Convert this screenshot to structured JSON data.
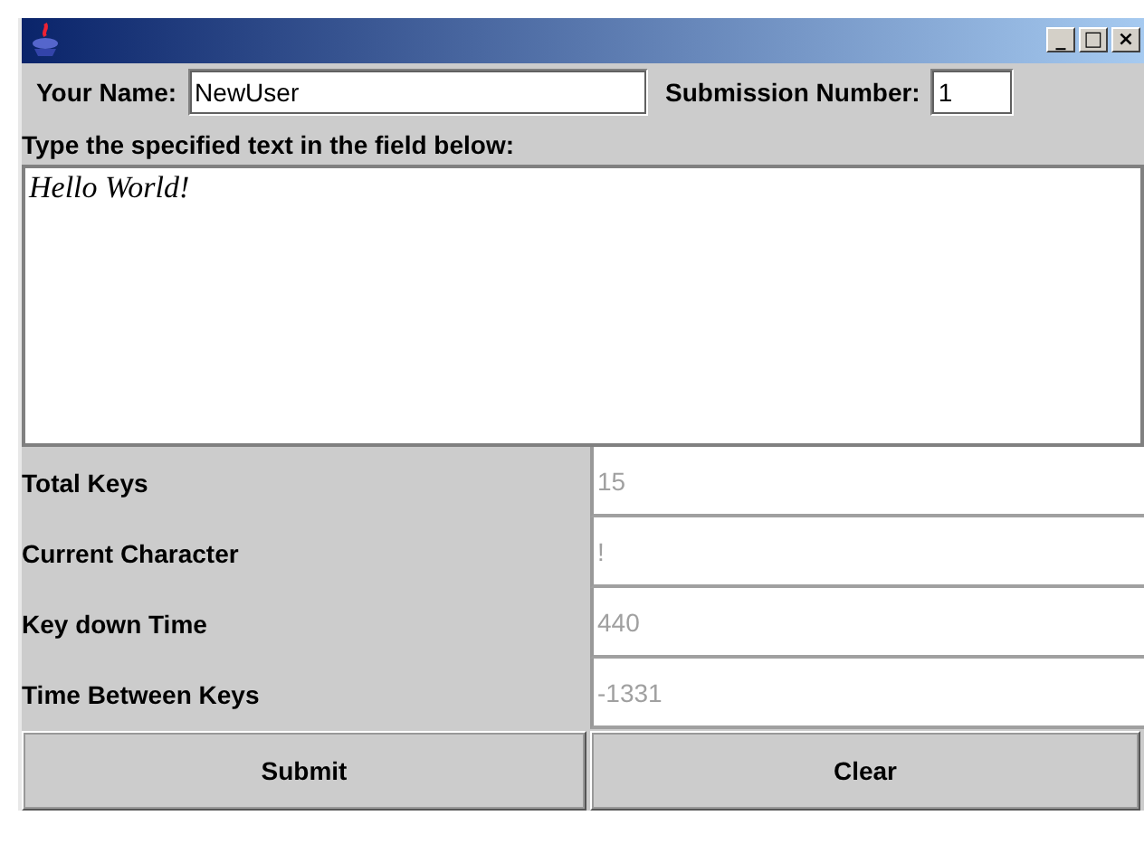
{
  "window": {
    "controls": [
      "_",
      "□",
      "×"
    ]
  },
  "name_field": {
    "label": "Your Name:",
    "value": "NewUser"
  },
  "submission_field": {
    "label": "Submission Number:",
    "value": "1"
  },
  "prompt": "Type the specified text in the field below:",
  "text_area": {
    "value": "Hello World!"
  },
  "stats": [
    {
      "label": "Total Keys",
      "value": "15",
      "disabled": true
    },
    {
      "label": "Current Character",
      "value": "!",
      "disabled": true
    },
    {
      "label": "Key down Time",
      "value": "440",
      "disabled": true
    },
    {
      "label": "Time Between Keys",
      "value": "-1331",
      "disabled": true
    }
  ],
  "buttons": [
    "Submit",
    "Clear"
  ]
}
